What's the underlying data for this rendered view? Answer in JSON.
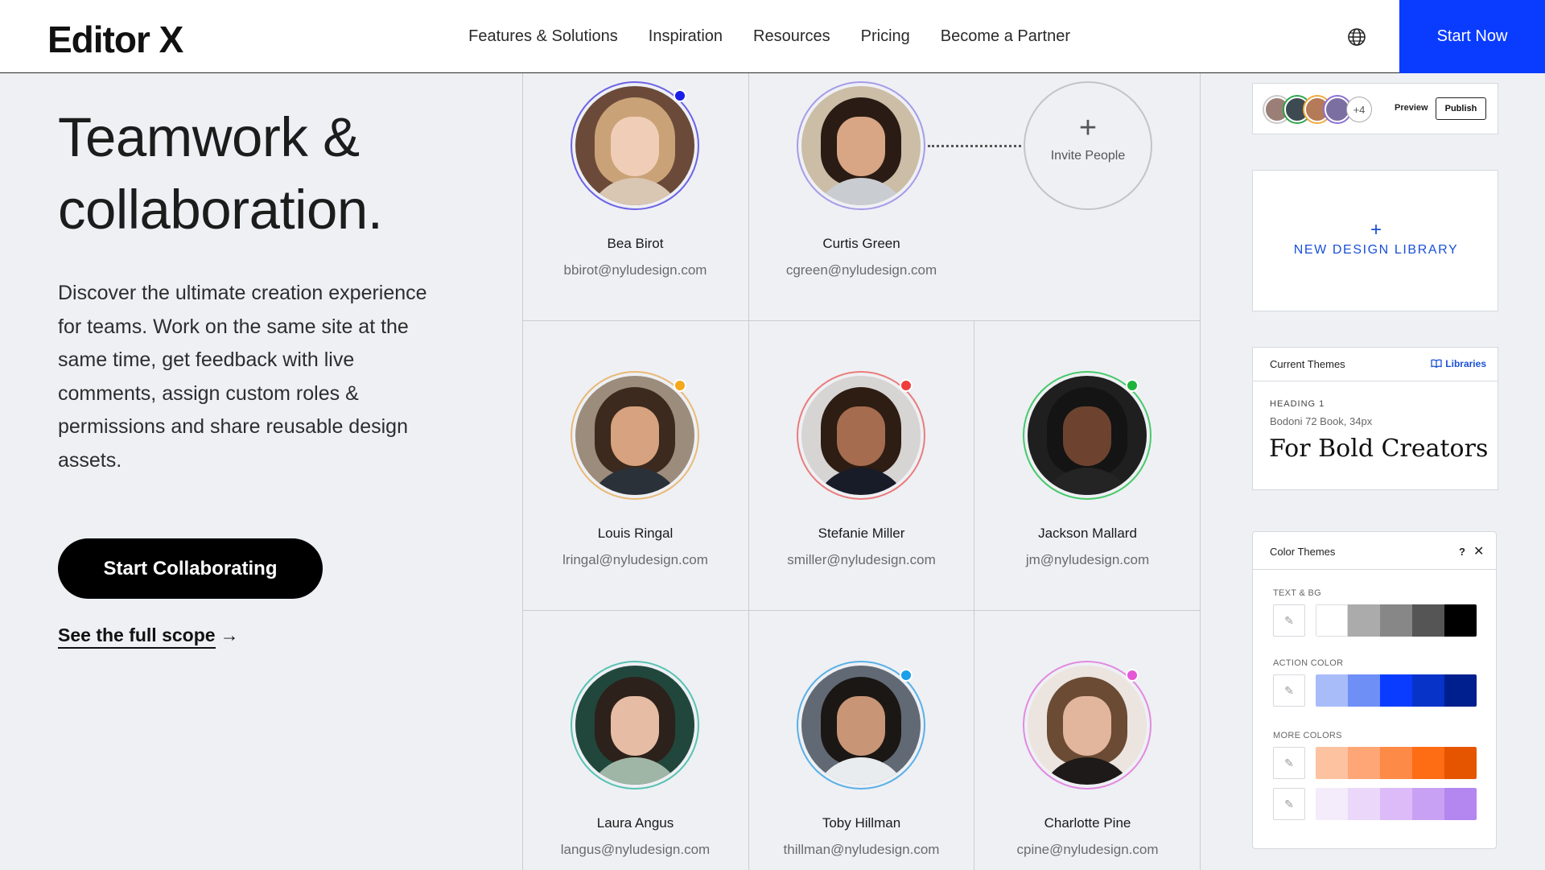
{
  "header": {
    "logo": "Editor X",
    "nav": [
      "Features & Solutions",
      "Inspiration",
      "Resources",
      "Pricing",
      "Become a Partner"
    ],
    "cta": "Start Now"
  },
  "hero": {
    "title_line1": "Teamwork &",
    "title_line2": "collaboration.",
    "description": "Discover the ultimate creation experience for teams. Work on the same site at the same time, get feedback with live comments, assign custom roles & permissions and share reusable design assets.",
    "cta": "Start Collaborating",
    "scope_link": "See the full scope",
    "scope_arrow": "→"
  },
  "people": [
    {
      "name": "Bea Birot",
      "email": "bbirot@nyludesign.com",
      "ring": "#6e63e6",
      "dot": "#1b1ee8",
      "bg": "#6b4a3a",
      "hair": "#caa277",
      "skin": "#f0cdb6",
      "shirt": "#d9c6b3"
    },
    {
      "name": "Curtis Green",
      "email": "cgreen@nyludesign.com",
      "ring": "#a79be8",
      "dot": "",
      "bg": "#cbbda6",
      "hair": "#2a1c14",
      "skin": "#d8a585",
      "shirt": "#c9ccd1"
    },
    {
      "name": "Louis Ringal",
      "email": "lringal@nyludesign.com",
      "ring": "#e9b978",
      "dot": "#f4a81a",
      "bg": "#9b8c7c",
      "hair": "#3b2a1d",
      "skin": "#d7a27f",
      "shirt": "#2b3139"
    },
    {
      "name": "Stefanie Miller",
      "email": "smiller@nyludesign.com",
      "ring": "#ea7c7c",
      "dot": "#ef3e3e",
      "bg": "#d7d4d4",
      "hair": "#2e1d13",
      "skin": "#a56c4f",
      "shirt": "#181c28"
    },
    {
      "name": "Jackson Mallard",
      "email": "jm@nyludesign.com",
      "ring": "#48c96a",
      "dot": "#1fb43c",
      "bg": "#1f1f1f",
      "hair": "#141414",
      "skin": "#6d4330",
      "shirt": "#242424"
    },
    {
      "name": "Laura Angus",
      "email": "langus@nyludesign.com",
      "ring": "#59c2b2",
      "dot": "",
      "bg": "#21473c",
      "hair": "#2d211b",
      "skin": "#e6bda4",
      "shirt": "#9fb6a6"
    },
    {
      "name": "Toby Hillman",
      "email": "thillman@nyludesign.com",
      "ring": "#5ab0e6",
      "dot": "#1a9fe8",
      "bg": "#616a74",
      "hair": "#1b1714",
      "skin": "#c99577",
      "shirt": "#e9ecef"
    },
    {
      "name": "Charlotte Pine",
      "email": "cpine@nyludesign.com",
      "ring": "#e28ae0",
      "dot": "#e657d6",
      "bg": "#ece4df",
      "hair": "#6b4b34",
      "skin": "#e2b69c",
      "shirt": "#1d1a19"
    }
  ],
  "invite": {
    "plus": "+",
    "label": "Invite People"
  },
  "collab_bar": {
    "avatars": [
      "#9b7f77",
      "#3d4a52",
      "#b57a58",
      "#7b6ea0"
    ],
    "more": "+4",
    "preview": "Preview",
    "publish": "Publish"
  },
  "new_library": {
    "plus": "+",
    "label": "NEW DESIGN LIBRARY"
  },
  "themes": {
    "title": "Current Themes",
    "libraries": "Libraries",
    "heading_label": "HEADING 1",
    "font": "Bodoni 72 Book, 34px",
    "sample": "For Bold Creators"
  },
  "color_themes": {
    "title": "Color Themes",
    "help": "?",
    "close": "✕",
    "sections": [
      {
        "label": "TEXT & BG",
        "rows": [
          [
            "#ffffff",
            "#ababab",
            "#878787",
            "#555555",
            "#000000"
          ]
        ]
      },
      {
        "label": "ACTION COLOR",
        "rows": [
          [
            "#a9bcfa",
            "#6e8ff6",
            "#0a3cff",
            "#0733c9",
            "#001f8f"
          ]
        ]
      },
      {
        "label": "MORE COLORS",
        "rows": [
          [
            "#fdc3a1",
            "#fea676",
            "#fe8a48",
            "#fe6c14",
            "#e55500"
          ],
          [
            "#f4ebfb",
            "#ead7fa",
            "#dcbbf8",
            "#c9a1f4",
            "#b486f0"
          ]
        ]
      }
    ]
  },
  "colors": {
    "accent": "#0a3cff",
    "link": "#1a4fd6",
    "background": "#eef0f4"
  }
}
